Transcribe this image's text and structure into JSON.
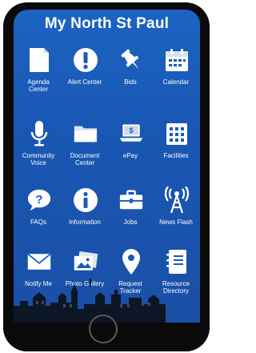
{
  "app": {
    "title": "My North St Paul"
  },
  "tiles": [
    {
      "label": "Agenda\nCenter",
      "icon": "document-icon"
    },
    {
      "label": "Alert Center",
      "icon": "exclamation-icon"
    },
    {
      "label": "Bids",
      "icon": "pushpin-icon"
    },
    {
      "label": "Calendar",
      "icon": "calendar-icon"
    },
    {
      "label": "Community\nVoice",
      "icon": "microphone-icon"
    },
    {
      "label": "Document\nCenter",
      "icon": "folder-icon"
    },
    {
      "label": "ePay",
      "icon": "laptop-dollar-icon"
    },
    {
      "label": "Facilities",
      "icon": "building-grid-icon"
    },
    {
      "label": "FAQs",
      "icon": "question-bubble-icon"
    },
    {
      "label": "Information",
      "icon": "info-icon"
    },
    {
      "label": "Jobs",
      "icon": "briefcase-icon"
    },
    {
      "label": "News Flash",
      "icon": "radio-tower-icon"
    },
    {
      "label": "Notify Me",
      "icon": "envelope-icon"
    },
    {
      "label": "Photo Gallery",
      "icon": "photos-icon"
    },
    {
      "label": "Request\nTracker",
      "icon": "map-pin-icon"
    },
    {
      "label": "Resource\nDirectory",
      "icon": "notebook-icon"
    }
  ]
}
